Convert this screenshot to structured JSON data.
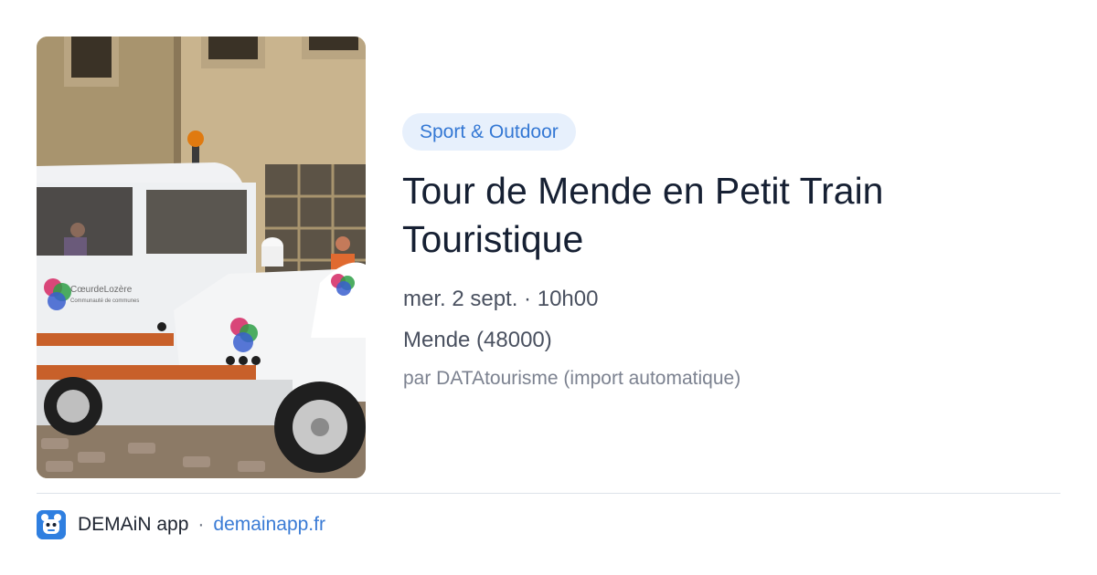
{
  "event": {
    "category": "Sport & Outdoor",
    "title": "Tour de Mende en Petit Train Touristique",
    "date": "mer. 2 sept. · 10h00",
    "location": "Mende (48000)",
    "source": "par DATAtourisme (import automatique)"
  },
  "photo": {
    "logo_text": "CœurdeLozère",
    "logo_subtext": "Communauté de communes"
  },
  "footer": {
    "app_name": "DEMAiN app",
    "separator": "·",
    "link": "demainapp.fr"
  },
  "colors": {
    "badge_bg": "#e7f0fc",
    "badge_text": "#3478d4",
    "title_text": "#162033",
    "link": "#3a7bd5",
    "app_icon": "#2f7fe0"
  }
}
